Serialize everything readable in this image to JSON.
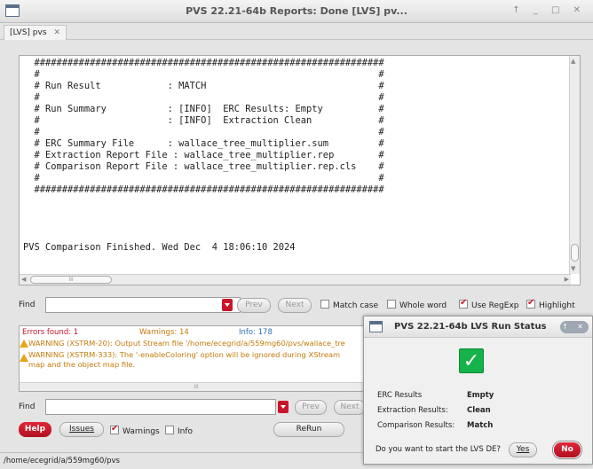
{
  "window": {
    "title": "PVS 22.21-64b  Reports: Done [LVS] pv...",
    "controls": "↑ _ □ ✕",
    "tab_label": "[LVS] pvs",
    "tab_close": "✕"
  },
  "report": {
    "lines": [
      "  ###############################################################",
      "  #                                                             #",
      "  # Run Result            : MATCH                               #",
      "  #                                                             #",
      "  # Run Summary           : [INFO]  ERC Results: Empty          #",
      "  #                       : [INFO]  Extraction Clean            #",
      "  #                                                             #",
      "  # ERC Summary File      : wallace_tree_multiplier.sum         #",
      "  # Extraction Report File : wallace_tree_multiplier.rep        #",
      "  # Comparison Report File : wallace_tree_multiplier.rep.cls    #",
      "  #                                                             #",
      "  ###############################################################",
      "",
      "",
      "",
      "",
      "PVS Comparison Finished. Wed Dec  4 18:06:10 2024"
    ]
  },
  "find_top": {
    "label": "Find",
    "value": "",
    "prev": "Prev",
    "next": "Next",
    "match_case": {
      "label": "Match case",
      "checked": false
    },
    "whole_word": {
      "label": "Whole word",
      "checked": false
    },
    "use_regexp": {
      "label": "Use RegExp",
      "checked": true
    },
    "highlight": {
      "label": "Highlight",
      "checked": true
    }
  },
  "messages": {
    "errors": "Errors found: 1",
    "warnings": "Warnings: 14",
    "info": "Info: 178",
    "rows": [
      "WARNING (XSTRM-20): Output Stream file '/home/ecegrid/a/559mg60/pvs/wallace_tre",
      "WARNING (XSTRM-333): The '-enableColoring' option will be ignored during XStream",
      "map and the object map file."
    ]
  },
  "find_bottom": {
    "label": "Find",
    "value": "",
    "prev": "Prev",
    "next": "Next"
  },
  "bottom_buttons": {
    "help": "Help",
    "issues": "Issues",
    "warnings": {
      "label": "Warnings",
      "checked": true
    },
    "info": {
      "label": "Info",
      "checked": false
    },
    "rerun": "ReRun"
  },
  "status_bar": "/home/ecegrid/a/559mg60/pvs",
  "dialog": {
    "title": "PVS 22.21-64b LVS  Run Status",
    "controls": "↑ ✕",
    "status_icon": "check-icon",
    "results": [
      {
        "key": "ERC Results",
        "value": "Empty"
      },
      {
        "key": "Extraction Results:",
        "value": "Clean"
      },
      {
        "key": "Comparison Results:",
        "value": "Match"
      }
    ],
    "question": "Do you want to start the LVS DE?",
    "yes": "Yes",
    "no": "No"
  },
  "colors": {
    "accent_red": "#c9162a",
    "success_green": "#16b24a",
    "warning_orange": "#c47a0b",
    "error_red": "#c9162a"
  }
}
